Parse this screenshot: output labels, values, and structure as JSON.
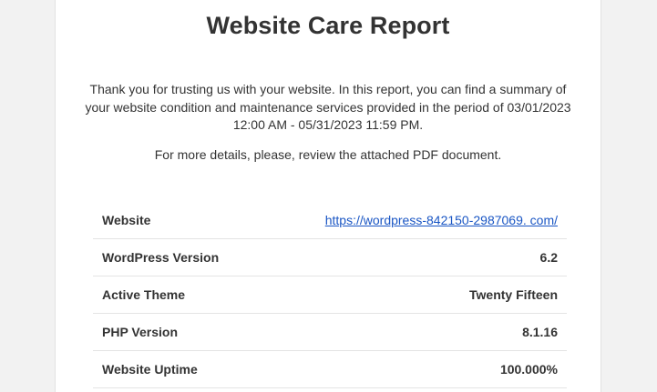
{
  "report": {
    "title": "Website Care Report",
    "intro": "Thank you for trusting us with your website. In this report, you can find a summary of your website condition and maintenance services provided in the period of 03/01/2023 12:00 AM - 05/31/2023 11:59 PM.",
    "details": "For more details, please, review the attached PDF document."
  },
  "rows": [
    {
      "label": "Website",
      "value": "https://wordpress-842150-2987069. com/"
    },
    {
      "label": "WordPress Version",
      "value": "6.2"
    },
    {
      "label": "Active Theme",
      "value": "Twenty Fifteen"
    },
    {
      "label": "PHP Version",
      "value": "8.1.16"
    },
    {
      "label": "Website Uptime",
      "value": "100.000%"
    }
  ],
  "colors": {
    "link": "#1a56c4",
    "text": "#333333",
    "background": "#f2f2f2",
    "card": "#ffffff"
  }
}
